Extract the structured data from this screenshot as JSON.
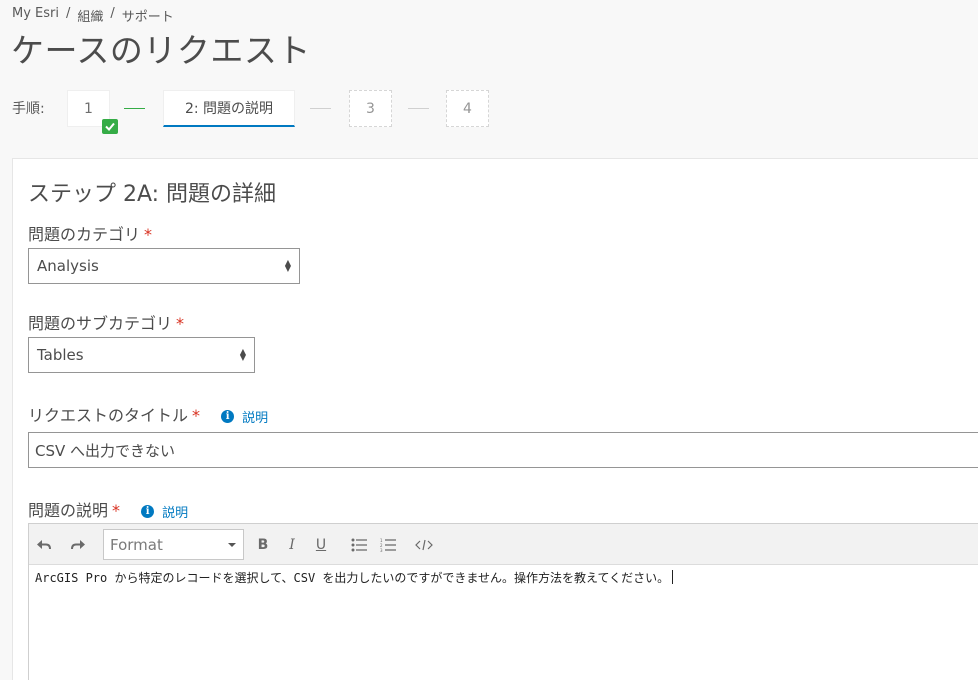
{
  "breadcrumb": [
    "My Esri",
    "組織",
    "サポート"
  ],
  "page_title": "ケースのリクエスト",
  "steps": {
    "label": "手順:",
    "items": [
      "1",
      "2:  問題の説明",
      "3",
      "4"
    ]
  },
  "section_title": "ステップ 2A: 問題の詳細",
  "category": {
    "label": "問題のカテゴリ",
    "required": "*",
    "value": "Analysis"
  },
  "subcategory": {
    "label": "問題のサブカテゴリ",
    "required": "*",
    "value": "Tables"
  },
  "request_title": {
    "label": "リクエストのタイトル",
    "required": "*",
    "help": "説明",
    "value": "CSV へ出力できない"
  },
  "description": {
    "label": "問題の説明",
    "required": "*",
    "help": "説明",
    "format_placeholder": "Format",
    "toolbar": {
      "bold": "B",
      "italic": "I",
      "underline": "U"
    },
    "text": "ArcGIS Pro から特定のレコードを選択して、CSV を出力したいのですができません。操作方法を教えてください。"
  },
  "colors": {
    "accent": "#0079c1",
    "success": "#35ac46",
    "required": "#d83020"
  }
}
